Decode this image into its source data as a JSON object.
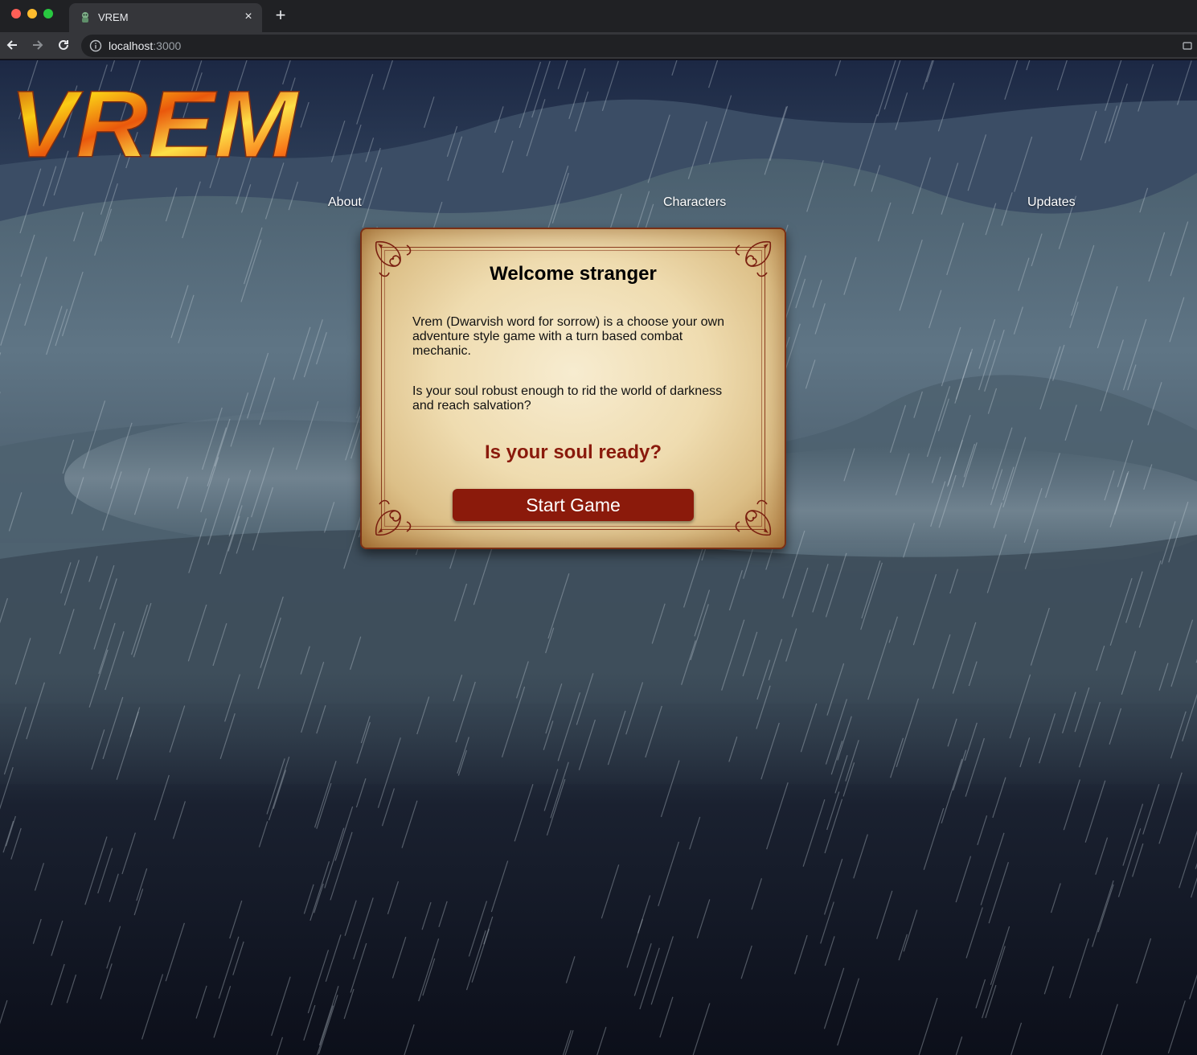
{
  "browser": {
    "tab_title": "VREM",
    "tab_close": "×",
    "new_tab": "+",
    "url_host": "localhost",
    "url_port": ":3000"
  },
  "site": {
    "logo_text": "VREM"
  },
  "nav": {
    "about": "About",
    "characters": "Characters",
    "updates": "Updates"
  },
  "card": {
    "title": "Welcome stranger",
    "paragraph1": "Vrem (Dwarvish word for sorrow) is a choose your own adventure style game with a turn based combat mechanic.",
    "paragraph2": "Is your soul robust enough to rid the world of darkness and reach salvation?",
    "prompt": "Is your soul ready?",
    "button": "Start Game"
  },
  "colors": {
    "button_bg": "#8b1a0b",
    "prompt_text": "#8a1a0c",
    "parchment": "#efdcb0",
    "logo_fire_outer": "#c2410c",
    "logo_fire_inner": "#facc15"
  }
}
